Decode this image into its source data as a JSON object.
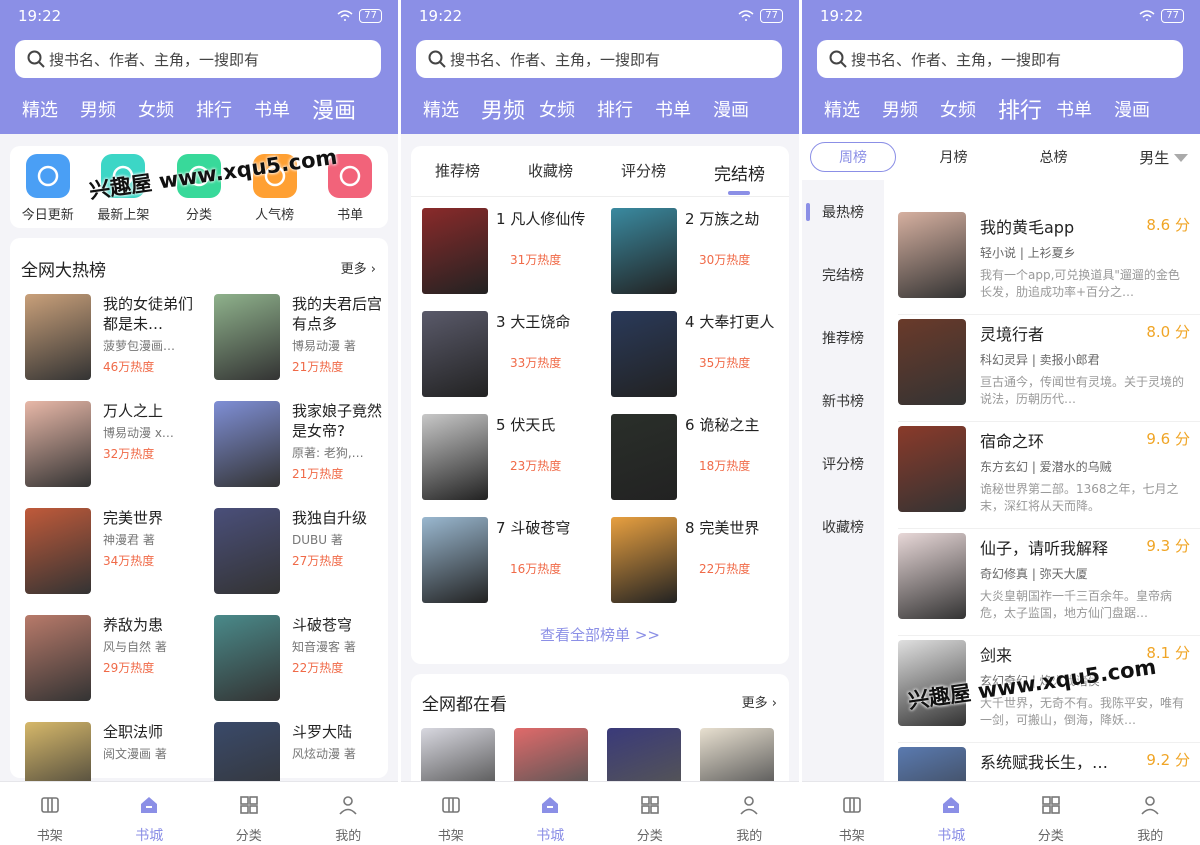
{
  "status": {
    "time": "19:22",
    "battery": "77"
  },
  "search_placeholder": "搜书名、作者、主角，一搜即有",
  "top_nav": [
    "精选",
    "男频",
    "女频",
    "排行",
    "书单",
    "漫画"
  ],
  "bottom_tabs": [
    "书架",
    "书城",
    "分类",
    "我的"
  ],
  "watermark": "兴趣屋 www.xqu5.com",
  "screen1": {
    "quick": [
      {
        "label": "今日更新",
        "icon": "clock-icon",
        "color": "#4a9ff5"
      },
      {
        "label": "最新上架",
        "icon": "star-icon",
        "color": "#3cd6c6"
      },
      {
        "label": "分类",
        "icon": "grid-icon",
        "color": "#38d99a"
      },
      {
        "label": "人气榜",
        "icon": "flame-icon",
        "color": "#ffa033"
      },
      {
        "label": "书单",
        "icon": "bookmark-icon",
        "color": "#f2637a"
      }
    ],
    "section_title": "全网大热榜",
    "more": "更多",
    "items": [
      {
        "title": "我的女徒弟们都是未…",
        "author": "菠萝包漫画…",
        "heat": "46万热度",
        "color": "#c9a07a"
      },
      {
        "title": "我的夫君后宫有点多",
        "author": "博易动漫 著",
        "heat": "21万热度",
        "color": "#8fb28c"
      },
      {
        "title": "万人之上",
        "author": "博易动漫 x…",
        "heat": "32万热度",
        "color": "#e8b8a8"
      },
      {
        "title": "我家娘子竟然是女帝?",
        "author": "原著: 老狗,…",
        "heat": "21万热度",
        "color": "#7f8fd6"
      },
      {
        "title": "完美世界",
        "author": "神漫君 著",
        "heat": "34万热度",
        "color": "#c05a3a"
      },
      {
        "title": "我独自升级",
        "author": "DUBU 著",
        "heat": "27万热度",
        "color": "#4a4f7a"
      },
      {
        "title": "养敌为患",
        "author": "风与自然 著",
        "heat": "29万热度",
        "color": "#b87a6a"
      },
      {
        "title": "斗破苍穹",
        "author": "知音漫客 著",
        "heat": "22万热度",
        "color": "#4a8a8a"
      },
      {
        "title": "全职法师",
        "author": "阅文漫画 著",
        "heat": "",
        "color": "#d6b86a"
      },
      {
        "title": "斗罗大陆",
        "author": "风炫动漫 著",
        "heat": "",
        "color": "#3a4a6a"
      }
    ]
  },
  "screen2": {
    "tabs": [
      "推荐榜",
      "收藏榜",
      "评分榜",
      "完结榜"
    ],
    "items": [
      {
        "rank": "1",
        "title": "凡人修仙传",
        "heat": "31万热度",
        "color": "#8a2a2a"
      },
      {
        "rank": "2",
        "title": "万族之劫",
        "heat": "30万热度",
        "color": "#3a8aa0"
      },
      {
        "rank": "3",
        "title": "大王饶命",
        "heat": "33万热度",
        "color": "#5a5a6a"
      },
      {
        "rank": "4",
        "title": "大奉打更人",
        "heat": "35万热度",
        "color": "#2a3a5a"
      },
      {
        "rank": "5",
        "title": "伏天氏",
        "heat": "23万热度",
        "color": "#c8c8c8"
      },
      {
        "rank": "6",
        "title": "诡秘之主",
        "heat": "18万热度",
        "color": "#2a2f2a"
      },
      {
        "rank": "7",
        "title": "斗破苍穹",
        "heat": "16万热度",
        "color": "#9ab8d0"
      },
      {
        "rank": "8",
        "title": "完美世界",
        "heat": "22万热度",
        "color": "#e8a040"
      }
    ],
    "view_all": "查看全部榜单 >>",
    "section2_title": "全网都在看",
    "more": "更多",
    "watching_colors": [
      "#d8d8e0",
      "#e06a6a",
      "#3a3a7a",
      "#e8e0d0"
    ]
  },
  "screen3": {
    "filters": [
      "周榜",
      "月榜",
      "总榜",
      "男生"
    ],
    "menu": [
      "最热榜",
      "完结榜",
      "推荐榜",
      "新书榜",
      "评分榜",
      "收藏榜"
    ],
    "items": [
      {
        "title": "我的黄毛app",
        "score": "8.6 分",
        "meta": "轻小说 | 上衫夏乡",
        "desc": "我有一个app,可兑换道具\"遛遛的金色长发，肋追成功率+百分之…",
        "color": "#d6b0a0"
      },
      {
        "title": "灵境行者",
        "score": "8.0 分",
        "meta": "科幻灵异 | 卖报小郎君",
        "desc": "亘古通今，传闻世有灵境。关于灵境的说法，历朝历代…",
        "color": "#6a3a2a"
      },
      {
        "title": "宿命之环",
        "score": "9.6 分",
        "meta": "东方玄幻 | 爱潜水的乌贼",
        "desc": "诡秘世界第二部。1368之年，七月之末，深红将从天而降。",
        "color": "#8a3a2a"
      },
      {
        "title": "仙子，请听我解释",
        "score": "9.3 分",
        "meta": "奇幻修真 | 弥天大厦",
        "desc": "大炎皇朝国祚一千三百余年。皇帝病危，太子监国，地方仙门盘踞…",
        "color": "#e8d8d8"
      },
      {
        "title": "剑来",
        "score": "8.1 分",
        "meta": "玄幻奇幻 | 烽火戏诸侯",
        "desc": "大千世界，无奇不有。我陈平安，唯有一剑，可搬山，倒海，降妖…",
        "color": "#e0e0e0"
      },
      {
        "title": "系统赋我长生，…",
        "score": "9.2 分",
        "meta": "",
        "desc": "",
        "color": "#5a7ab0"
      }
    ]
  }
}
